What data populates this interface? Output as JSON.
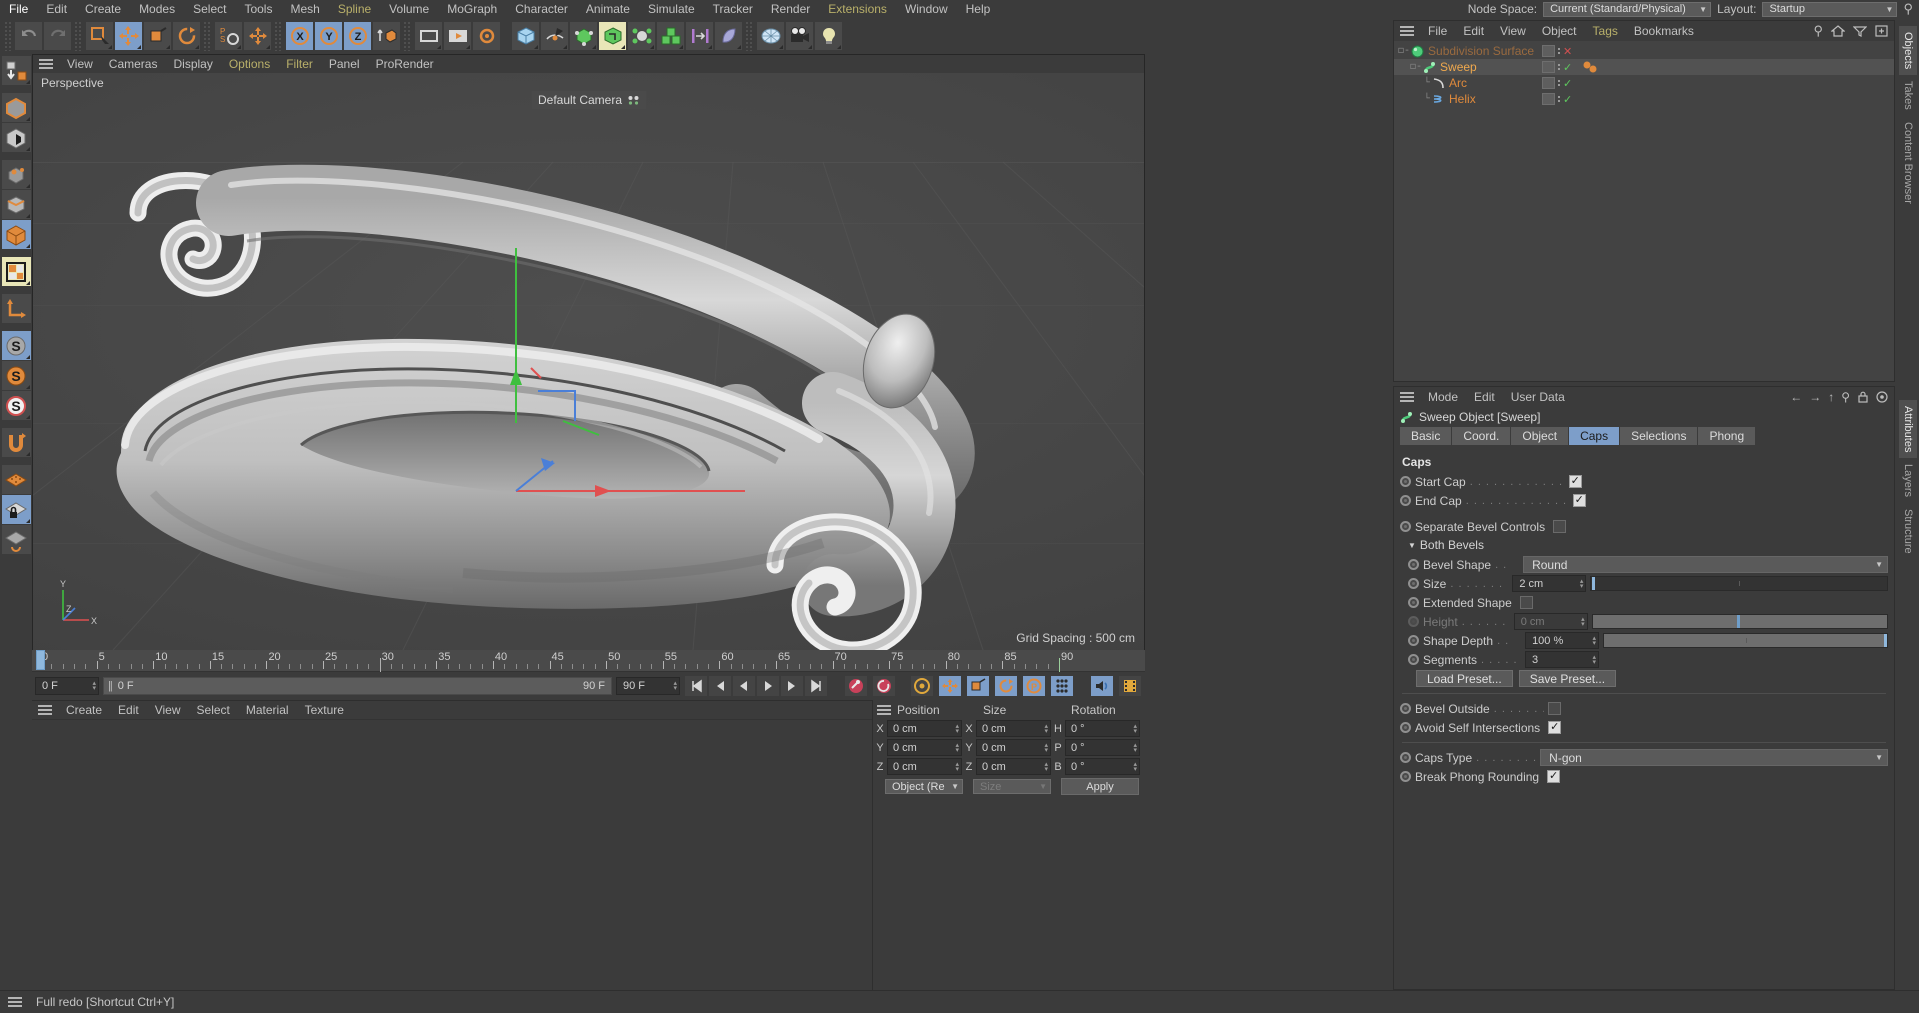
{
  "app": {
    "status_text": "Full redo [Shortcut Ctrl+Y]"
  },
  "menubar": {
    "items": [
      {
        "label": "File"
      },
      {
        "label": "Edit"
      },
      {
        "label": "Create"
      },
      {
        "label": "Modes"
      },
      {
        "label": "Select"
      },
      {
        "label": "Tools"
      },
      {
        "label": "Mesh"
      },
      {
        "label": "Spline"
      },
      {
        "label": "Volume"
      },
      {
        "label": "MoGraph"
      },
      {
        "label": "Character"
      },
      {
        "label": "Animate"
      },
      {
        "label": "Simulate"
      },
      {
        "label": "Tracker"
      },
      {
        "label": "Render"
      },
      {
        "label": "Extensions"
      },
      {
        "label": "Window"
      },
      {
        "label": "Help"
      }
    ],
    "node_space_label": "Node Space:",
    "node_space_value": "Current (Standard/Physical)",
    "layout_label": "Layout:",
    "layout_value": "Startup"
  },
  "viewport": {
    "menu": [
      {
        "label": "View"
      },
      {
        "label": "Cameras"
      },
      {
        "label": "Display"
      },
      {
        "label": "Options"
      },
      {
        "label": "Filter"
      },
      {
        "label": "Panel"
      },
      {
        "label": "ProRender"
      }
    ],
    "view_name": "Perspective",
    "camera_name": "Default Camera",
    "grid_spacing": "Grid Spacing : 500 cm",
    "axis_x": "X",
    "axis_y": "Y",
    "axis_z": "Z"
  },
  "timeline": {
    "ticks": [
      {
        "label": "0",
        "value": 0
      },
      {
        "label": "5",
        "value": 5
      },
      {
        "label": "10",
        "value": 10
      },
      {
        "label": "15",
        "value": 15
      },
      {
        "label": "20",
        "value": 20
      },
      {
        "label": "25",
        "value": 25
      },
      {
        "label": "30",
        "value": 30
      },
      {
        "label": "35",
        "value": 35
      },
      {
        "label": "40",
        "value": 40
      },
      {
        "label": "45",
        "value": 45
      },
      {
        "label": "50",
        "value": 50
      },
      {
        "label": "55",
        "value": 55
      },
      {
        "label": "60",
        "value": 60
      },
      {
        "label": "65",
        "value": 65
      },
      {
        "label": "70",
        "value": 70
      },
      {
        "label": "75",
        "value": 75
      },
      {
        "label": "80",
        "value": 80
      },
      {
        "label": "85",
        "value": 85
      },
      {
        "label": "90",
        "value": 90
      }
    ],
    "range_min": 0,
    "range_max": 90,
    "current_frame_field": "0 F",
    "current_frame_bar": "0 F",
    "end_frame_left": "90 F",
    "end_frame_right": "90 F",
    "preview_end": "0 F",
    "playhead_frame": 0
  },
  "material_manager": {
    "menu": [
      {
        "label": "Create"
      },
      {
        "label": "Edit"
      },
      {
        "label": "View"
      },
      {
        "label": "Select"
      },
      {
        "label": "Material"
      },
      {
        "label": "Texture"
      }
    ]
  },
  "coordinates": {
    "headers": [
      "Position",
      "Size",
      "Rotation"
    ],
    "rows": [
      {
        "pos_axis": "X",
        "pos_value": "0 cm",
        "size_axis": "X",
        "size_value": "0 cm",
        "rot_axis": "H",
        "rot_value": "0 °"
      },
      {
        "pos_axis": "Y",
        "pos_value": "0 cm",
        "size_axis": "Y",
        "size_value": "0 cm",
        "rot_axis": "P",
        "rot_value": "0 °"
      },
      {
        "pos_axis": "Z",
        "pos_value": "0 cm",
        "size_axis": "Z",
        "size_value": "0 cm",
        "rot_axis": "B",
        "rot_value": "0 °"
      }
    ],
    "mode_select": "Object (Rel)",
    "size_select": "Size",
    "apply_label": "Apply"
  },
  "object_manager": {
    "menu": [
      {
        "label": "File"
      },
      {
        "label": "Edit"
      },
      {
        "label": "View"
      },
      {
        "label": "Object"
      },
      {
        "label": "Tags",
        "accent": true
      },
      {
        "label": "Bookmarks"
      }
    ],
    "rows": [
      {
        "name": "Subdivision Surface",
        "indent": 0,
        "icon": "subdivision-surface-icon",
        "visibility": "x",
        "selected": false,
        "dim": true
      },
      {
        "name": "Sweep",
        "indent": 1,
        "icon": "sweep-icon",
        "visibility": "check",
        "selected": true,
        "dim": false,
        "has_tags": true
      },
      {
        "name": "Arc",
        "indent": 2,
        "icon": "arc-spline-icon",
        "visibility": "check",
        "selected": false,
        "dim": false
      },
      {
        "name": "Helix",
        "indent": 2,
        "icon": "helix-spline-icon",
        "visibility": "check",
        "selected": false,
        "dim": false
      }
    ]
  },
  "attribute_manager": {
    "menu": [
      {
        "label": "Mode"
      },
      {
        "label": "Edit"
      },
      {
        "label": "User Data"
      }
    ],
    "object_title": "Sweep Object [Sweep]",
    "tabs": [
      {
        "label": "Basic",
        "active": false
      },
      {
        "label": "Coord.",
        "active": false
      },
      {
        "label": "Object",
        "active": false
      },
      {
        "label": "Caps",
        "active": true
      },
      {
        "label": "Selections",
        "active": false
      },
      {
        "label": "Phong",
        "active": false
      }
    ],
    "group_title": "Caps",
    "start_cap": {
      "label": "Start Cap",
      "checked": true
    },
    "end_cap": {
      "label": "End Cap",
      "checked": true
    },
    "separate_bevel_controls": {
      "label": "Separate Bevel Controls",
      "checked": false
    },
    "both_bevels_label": "Both Bevels",
    "bevel_shape": {
      "label": "Bevel Shape",
      "value": "Round"
    },
    "size": {
      "label": "Size",
      "value": "2 cm",
      "slider_percent": 1
    },
    "extended_shape": {
      "label": "Extended Shape",
      "checked": false
    },
    "height": {
      "label": "Height",
      "value": "0 cm",
      "disabled": true,
      "slider_percent": 50
    },
    "shape_depth": {
      "label": "Shape Depth",
      "value": "100 %",
      "slider_percent": 100
    },
    "segments": {
      "label": "Segments",
      "value": "3"
    },
    "load_preset_label": "Load Preset...",
    "save_preset_label": "Save Preset...",
    "bevel_outside": {
      "label": "Bevel Outside",
      "checked": false
    },
    "avoid_self_intersections": {
      "label": "Avoid Self Intersections",
      "checked": true
    },
    "caps_type": {
      "label": "Caps Type",
      "value": "N-gon"
    },
    "break_phong_rounding": {
      "label": "Break Phong Rounding",
      "checked": true
    }
  },
  "vertical_tabs": [
    {
      "label": "Objects",
      "active": true
    },
    {
      "label": "Takes",
      "active": false
    },
    {
      "label": "Content Browser",
      "active": false
    },
    {
      "label": "Attributes",
      "active": true
    },
    {
      "label": "Layers",
      "active": false
    },
    {
      "label": "Structure",
      "active": false
    }
  ],
  "colors": {
    "accent_orange": "#e08a3c",
    "accent_blue": "#7d9ec9",
    "menu_accent": "#b9b06a",
    "check_green": "#5ec75e",
    "panel_bg": "#3b3b3b"
  }
}
